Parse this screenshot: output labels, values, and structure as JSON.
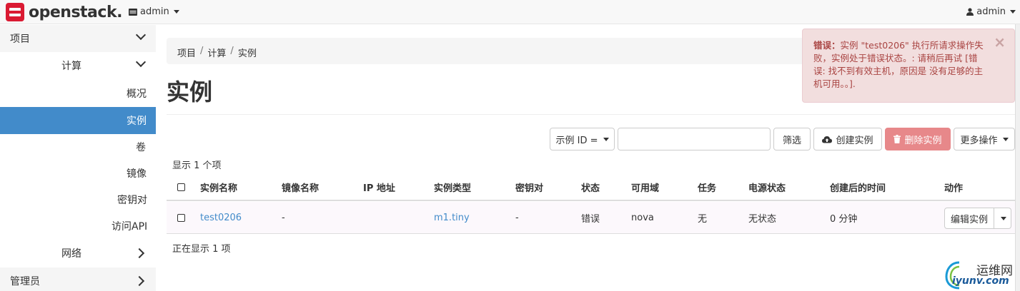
{
  "navbar": {
    "brand": "openstack.",
    "project_label": "admin",
    "user_label": "admin"
  },
  "sidebar": {
    "project": "项目",
    "compute": "计算",
    "items": [
      "概况",
      "实例",
      "卷",
      "镜像",
      "密钥对",
      "访问API"
    ],
    "network": "网络",
    "admin": "管理员"
  },
  "breadcrumb": [
    "项目",
    "计算",
    "实例"
  ],
  "page_title": "实例",
  "toolbar": {
    "filter_label": "示例 ID =",
    "search_value": "",
    "filter_button": "筛选",
    "create_button": "创建实例",
    "delete_button": "删除实例",
    "more_button": "更多操作"
  },
  "table": {
    "count_top": "显示 1 个项",
    "count_bottom": "正在显示 1 项",
    "headers": [
      "实例名称",
      "镜像名称",
      "IP 地址",
      "实例类型",
      "密钥对",
      "状态",
      "可用域",
      "任务",
      "电源状态",
      "创建后的时间",
      "动作"
    ],
    "rows": [
      {
        "name": "test0206",
        "image": "-",
        "ip": "",
        "flavor": "m1.tiny",
        "keypair": "-",
        "status": "错误",
        "zone": "nova",
        "task": "无",
        "power": "无状态",
        "age": "0 分钟",
        "action": "编辑实例"
      }
    ]
  },
  "alert": {
    "title": "错误：",
    "message": "实例 \"test0206\" 执行所请求操作失败，实例处于错误状态。: 请稍后再试 [错误: 找不到有效主机，原因是 没有足够的主机可用。。]."
  },
  "watermark": {
    "cn": "运维网",
    "url": "iyunv.com"
  }
}
